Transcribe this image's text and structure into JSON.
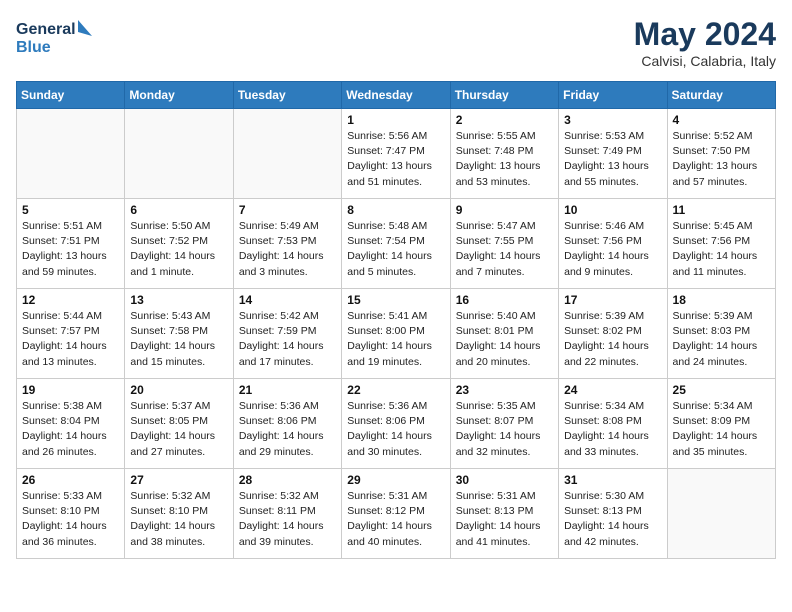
{
  "header": {
    "logo_line1": "General",
    "logo_line2": "Blue",
    "month": "May 2024",
    "location": "Calvisi, Calabria, Italy"
  },
  "weekdays": [
    "Sunday",
    "Monday",
    "Tuesday",
    "Wednesday",
    "Thursday",
    "Friday",
    "Saturday"
  ],
  "weeks": [
    [
      {
        "day": "",
        "info": "",
        "empty": true
      },
      {
        "day": "",
        "info": "",
        "empty": true
      },
      {
        "day": "",
        "info": "",
        "empty": true
      },
      {
        "day": "1",
        "info": "Sunrise: 5:56 AM\nSunset: 7:47 PM\nDaylight: 13 hours\nand 51 minutes.",
        "empty": false
      },
      {
        "day": "2",
        "info": "Sunrise: 5:55 AM\nSunset: 7:48 PM\nDaylight: 13 hours\nand 53 minutes.",
        "empty": false
      },
      {
        "day": "3",
        "info": "Sunrise: 5:53 AM\nSunset: 7:49 PM\nDaylight: 13 hours\nand 55 minutes.",
        "empty": false
      },
      {
        "day": "4",
        "info": "Sunrise: 5:52 AM\nSunset: 7:50 PM\nDaylight: 13 hours\nand 57 minutes.",
        "empty": false
      }
    ],
    [
      {
        "day": "5",
        "info": "Sunrise: 5:51 AM\nSunset: 7:51 PM\nDaylight: 13 hours\nand 59 minutes.",
        "empty": false
      },
      {
        "day": "6",
        "info": "Sunrise: 5:50 AM\nSunset: 7:52 PM\nDaylight: 14 hours\nand 1 minute.",
        "empty": false
      },
      {
        "day": "7",
        "info": "Sunrise: 5:49 AM\nSunset: 7:53 PM\nDaylight: 14 hours\nand 3 minutes.",
        "empty": false
      },
      {
        "day": "8",
        "info": "Sunrise: 5:48 AM\nSunset: 7:54 PM\nDaylight: 14 hours\nand 5 minutes.",
        "empty": false
      },
      {
        "day": "9",
        "info": "Sunrise: 5:47 AM\nSunset: 7:55 PM\nDaylight: 14 hours\nand 7 minutes.",
        "empty": false
      },
      {
        "day": "10",
        "info": "Sunrise: 5:46 AM\nSunset: 7:56 PM\nDaylight: 14 hours\nand 9 minutes.",
        "empty": false
      },
      {
        "day": "11",
        "info": "Sunrise: 5:45 AM\nSunset: 7:56 PM\nDaylight: 14 hours\nand 11 minutes.",
        "empty": false
      }
    ],
    [
      {
        "day": "12",
        "info": "Sunrise: 5:44 AM\nSunset: 7:57 PM\nDaylight: 14 hours\nand 13 minutes.",
        "empty": false
      },
      {
        "day": "13",
        "info": "Sunrise: 5:43 AM\nSunset: 7:58 PM\nDaylight: 14 hours\nand 15 minutes.",
        "empty": false
      },
      {
        "day": "14",
        "info": "Sunrise: 5:42 AM\nSunset: 7:59 PM\nDaylight: 14 hours\nand 17 minutes.",
        "empty": false
      },
      {
        "day": "15",
        "info": "Sunrise: 5:41 AM\nSunset: 8:00 PM\nDaylight: 14 hours\nand 19 minutes.",
        "empty": false
      },
      {
        "day": "16",
        "info": "Sunrise: 5:40 AM\nSunset: 8:01 PM\nDaylight: 14 hours\nand 20 minutes.",
        "empty": false
      },
      {
        "day": "17",
        "info": "Sunrise: 5:39 AM\nSunset: 8:02 PM\nDaylight: 14 hours\nand 22 minutes.",
        "empty": false
      },
      {
        "day": "18",
        "info": "Sunrise: 5:39 AM\nSunset: 8:03 PM\nDaylight: 14 hours\nand 24 minutes.",
        "empty": false
      }
    ],
    [
      {
        "day": "19",
        "info": "Sunrise: 5:38 AM\nSunset: 8:04 PM\nDaylight: 14 hours\nand 26 minutes.",
        "empty": false
      },
      {
        "day": "20",
        "info": "Sunrise: 5:37 AM\nSunset: 8:05 PM\nDaylight: 14 hours\nand 27 minutes.",
        "empty": false
      },
      {
        "day": "21",
        "info": "Sunrise: 5:36 AM\nSunset: 8:06 PM\nDaylight: 14 hours\nand 29 minutes.",
        "empty": false
      },
      {
        "day": "22",
        "info": "Sunrise: 5:36 AM\nSunset: 8:06 PM\nDaylight: 14 hours\nand 30 minutes.",
        "empty": false
      },
      {
        "day": "23",
        "info": "Sunrise: 5:35 AM\nSunset: 8:07 PM\nDaylight: 14 hours\nand 32 minutes.",
        "empty": false
      },
      {
        "day": "24",
        "info": "Sunrise: 5:34 AM\nSunset: 8:08 PM\nDaylight: 14 hours\nand 33 minutes.",
        "empty": false
      },
      {
        "day": "25",
        "info": "Sunrise: 5:34 AM\nSunset: 8:09 PM\nDaylight: 14 hours\nand 35 minutes.",
        "empty": false
      }
    ],
    [
      {
        "day": "26",
        "info": "Sunrise: 5:33 AM\nSunset: 8:10 PM\nDaylight: 14 hours\nand 36 minutes.",
        "empty": false
      },
      {
        "day": "27",
        "info": "Sunrise: 5:32 AM\nSunset: 8:10 PM\nDaylight: 14 hours\nand 38 minutes.",
        "empty": false
      },
      {
        "day": "28",
        "info": "Sunrise: 5:32 AM\nSunset: 8:11 PM\nDaylight: 14 hours\nand 39 minutes.",
        "empty": false
      },
      {
        "day": "29",
        "info": "Sunrise: 5:31 AM\nSunset: 8:12 PM\nDaylight: 14 hours\nand 40 minutes.",
        "empty": false
      },
      {
        "day": "30",
        "info": "Sunrise: 5:31 AM\nSunset: 8:13 PM\nDaylight: 14 hours\nand 41 minutes.",
        "empty": false
      },
      {
        "day": "31",
        "info": "Sunrise: 5:30 AM\nSunset: 8:13 PM\nDaylight: 14 hours\nand 42 minutes.",
        "empty": false
      },
      {
        "day": "",
        "info": "",
        "empty": true
      }
    ]
  ]
}
